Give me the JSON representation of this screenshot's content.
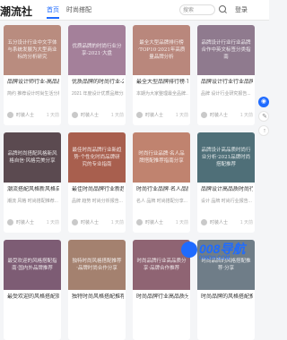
{
  "header": {
    "logo": "潮流社",
    "tabs": [
      {
        "label": "首页",
        "active": true
      },
      {
        "label": "时尚搭配",
        "active": false
      }
    ],
    "search_placeholder": "搜索",
    "login": "登录",
    "accent": "#1f6bff"
  },
  "cards": [
    {
      "thumb_text": "五分设计行业中文字体与系统发展为大型商业标的分析研究",
      "bg": "#b98c7f",
      "title": "品牌设计师行业-高品质搭配技...",
      "desc": "简约 推荐设计时尚生活分析...",
      "author": "时装人士",
      "date": "1 天前"
    },
    {
      "thumb_text": "优质品牌的时尚行业分享-2021·大盘",
      "bg": "#a4809a",
      "title": "优质品牌的时尚行业-2021大盘...",
      "desc": "2021 年度设计优质品牌分析...",
      "author": "时装人士",
      "date": "1 天前"
    },
    {
      "thumb_text": "最全大型品牌排行榜·TOP10·2021年高质量品牌分析",
      "bg": "#b9877c",
      "title": "最全大型品牌排行榜·TOP10已...",
      "desc": "本期为大家整理最全品牌...",
      "author": "时装人士",
      "date": "1 天前"
    },
    {
      "thumb_text": "品牌设计行业行业品牌合作中英文标签分类指南",
      "bg": "#8f7a8e",
      "title": "品牌设计行业行业品牌合作中...",
      "desc": "品牌 设计行业研究报告...",
      "author": "时装人士",
      "date": "1 天前"
    },
    {
      "thumb_text": "品牌时尚搭配风格新风格自信·风格完美分享",
      "bg": "#5b4a50",
      "title": "潮流搭配风格新风格自信·品...",
      "desc": "潮流 风格 时尚搭配推荐...",
      "author": "时装人士",
      "date": "1 天前"
    },
    {
      "thumb_text": "最佳时尚品牌行业新趋势·个性化时尚品牌研究的专业指南",
      "bg": "#a85f4e",
      "title": "最佳时尚品牌行业新趋势·个...",
      "desc": "品牌 趋势 时尚分析报告...",
      "author": "时装人士",
      "date": "1 天前"
    },
    {
      "thumb_text": "时尚行业品牌·名人品牌搭配推荐指南分享",
      "bg": "#c0836f",
      "title": "时尚行业品牌·名人品牌推荐...",
      "desc": "名人 品牌 时尚搭配分享...",
      "author": "时装人士",
      "date": "1 天前"
    },
    {
      "thumb_text": "品牌设计高品质时尚行业分析·2021品牌时尚搭配推荐",
      "bg": "#4f6f78",
      "title": "品牌设计高品质时尚行业分析...",
      "desc": "设计 品牌 时尚行业报告...",
      "author": "时装人士",
      "date": "1 天前"
    },
    {
      "thumb_text": "最受欢迎的风格搭配指南·国内外品牌推荐",
      "bg": "#7d5c74",
      "title": "最受欢迎的风格搭配指南...",
      "desc": "",
      "author": "",
      "date": ""
    },
    {
      "thumb_text": "独特时尚风格搭配推荐·品牌时尚合作分享",
      "bg": "#a4816f",
      "title": "独特时尚风格搭配推荐...",
      "desc": "",
      "author": "",
      "date": ""
    },
    {
      "thumb_text": "时尚品牌行业高品质分享·品牌合作推荐",
      "bg": "#8f6473",
      "title": "时尚品牌行业高品质分享...",
      "desc": "",
      "author": "",
      "date": ""
    },
    {
      "thumb_text": "时尚品牌的风格搭配推荐·分享",
      "bg": "#6f7d88",
      "title": "时尚品牌的风格搭配推荐...",
      "desc": "",
      "author": "",
      "date": ""
    }
  ],
  "side": {
    "buttons": [
      {
        "glyph": "◉",
        "icon": "customer-service-icon"
      },
      {
        "glyph": "✎",
        "icon": "edit-icon"
      },
      {
        "glyph": "↑",
        "icon": "back-to-top-icon"
      }
    ]
  },
  "watermark": {
    "text": "008导航",
    "sub": "008DH.COM"
  }
}
